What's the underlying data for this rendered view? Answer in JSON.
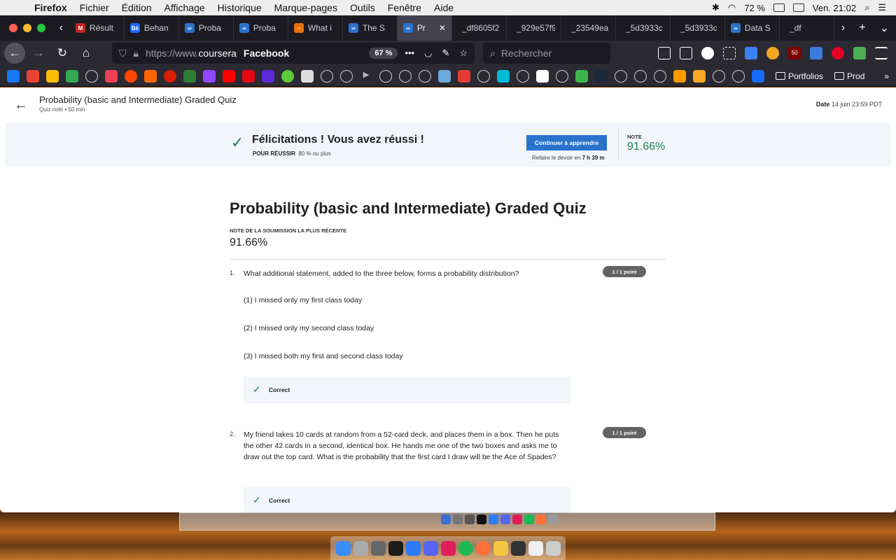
{
  "menubar": {
    "app": "Firefox",
    "items": [
      "Fichier",
      "Édition",
      "Affichage",
      "Historique",
      "Marque-pages",
      "Outils",
      "Fenêtre",
      "Aide"
    ],
    "battery": "72 %",
    "clock": "Ven. 21:02"
  },
  "tabs": [
    {
      "title": "Résult",
      "color": "#c5221f",
      "glyph": "M"
    },
    {
      "title": "Behan",
      "color": "#1769ff",
      "glyph": "Bē"
    },
    {
      "title": "Proba",
      "color": "#2a73cc",
      "glyph": "∞"
    },
    {
      "title": "Proba",
      "color": "#2a73cc",
      "glyph": "∞"
    },
    {
      "title": "What i",
      "color": "#e8710a",
      "glyph": "○"
    },
    {
      "title": "The S",
      "color": "#2a73cc",
      "glyph": "∞"
    },
    {
      "title": "Pr",
      "color": "#2a73cc",
      "glyph": "∞",
      "active": true
    },
    {
      "title": "_df8605f2",
      "color": "",
      "glyph": ""
    },
    {
      "title": "_929e57f9",
      "color": "",
      "glyph": ""
    },
    {
      "title": "_23549ea",
      "color": "",
      "glyph": ""
    },
    {
      "title": "_5d3933c",
      "color": "",
      "glyph": ""
    },
    {
      "title": "_5d3933c",
      "color": "",
      "glyph": ""
    },
    {
      "title": "Data S",
      "color": "#2a73cc",
      "glyph": "∞"
    },
    {
      "title": "_df",
      "color": "",
      "glyph": ""
    }
  ],
  "navbar": {
    "url_prefix": "https://www.",
    "url_site": "coursera",
    "facebook_label": "Facebook",
    "zoom": "67 %",
    "search_placeholder": "Rechercher",
    "extension_badge": "50"
  },
  "bookmarks": {
    "folders": [
      "Portfolios",
      "Prod"
    ]
  },
  "page": {
    "header_title": "Probability (basic and Intermediate) Graded Quiz",
    "header_sub": "Quiz noté • 50  min",
    "due_label": "Date",
    "due_value": "14 juin 23:59 PDT"
  },
  "banner": {
    "congrats": "Félicitations ! Vous avez réussi !",
    "pass_label": "POUR RÉUSSIR",
    "pass_value": "80 % ou plus",
    "continue_button": "Continuer à apprendre",
    "redo_text": "Refaire le devoir en",
    "redo_time": "7 h 39 m",
    "note_label": "NOTE",
    "note_value": "91.66%"
  },
  "quiz": {
    "title": "Probability (basic and Intermediate) Graded Quiz",
    "recent_label": "NOTE DE LA SOUMISSION LA PLUS RÉCENTE",
    "recent_score": "91.66%",
    "questions": [
      {
        "number": "1.",
        "text": "What additional statement, added to the three below, forms a probability distribution?",
        "points": "1 / 1 point",
        "statements": [
          "(1) I missed only my first class today",
          "(2) I missed only my second class today",
          "(3) I missed both my first and second class today"
        ],
        "feedback": "Correct"
      },
      {
        "number": "2.",
        "text": "My friend takes 10 cards at random from a 52-card deck, and places them in a box. Then he puts the other 42 cards in a second, identical box. He hands me one of the two boxes and asks me to draw out the top card. What is the probability that the first card I draw will be the Ace of Spades?",
        "points": "1 / 1 point",
        "feedback": "Correct"
      }
    ]
  }
}
